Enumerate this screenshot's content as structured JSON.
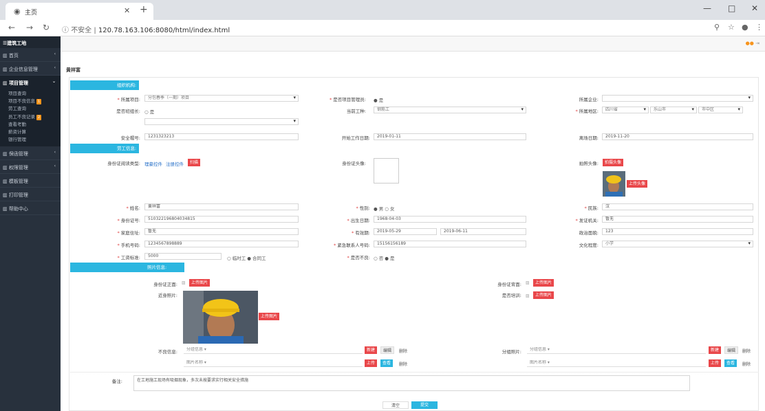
{
  "browser": {
    "tab_title": "主页",
    "url_insecure": "不安全",
    "url": "120.78.163.106:8080/html/index.html"
  },
  "sidebar": {
    "brand": "建筑工地",
    "items": [
      {
        "label": "首页",
        "arrow": "‹"
      },
      {
        "label": "企业信息管理",
        "arrow": "‹"
      },
      {
        "label": "项目管理",
        "arrow": "⌄"
      },
      {
        "label": "保函管理",
        "arrow": "‹"
      },
      {
        "label": "权限管理",
        "arrow": "‹"
      },
      {
        "label": "模板管理",
        "arrow": ""
      },
      {
        "label": "打印管理",
        "arrow": ""
      },
      {
        "label": "帮助中心",
        "arrow": ""
      }
    ],
    "subitems": [
      {
        "label": "项目查询",
        "badge": ""
      },
      {
        "label": "项目不良信息",
        "badge": "1"
      },
      {
        "label": "劳工查询",
        "badge": ""
      },
      {
        "label": "员工不良记录",
        "badge": "2"
      },
      {
        "label": "查看考勤",
        "badge": ""
      },
      {
        "label": "薪资计算",
        "badge": ""
      },
      {
        "label": "银行管理",
        "badge": ""
      }
    ]
  },
  "breadcrumb": "黄祥富",
  "form": {
    "sec1": "组织机构:",
    "sec2": "劳工信息:",
    "sec3": "照片信息:",
    "project_label": "所属项目:",
    "project_value": "分包春季（一期）项目",
    "is_pm_label": "是否项目管理员:",
    "is_pm_value": "● 是",
    "company_label": "所属企业:",
    "is_leader_label": "是否班组长:",
    "is_leader_value": "○ 是",
    "worktype_label": "当前工种:",
    "worktype_value": "钢筋工",
    "region_label": "所属地区:",
    "region_province": "四川省",
    "region_city": "乐山市",
    "region_district": "市中区",
    "safety_label": "安全帽号:",
    "safety_value": "1231323213",
    "start_label": "开始工作日期:",
    "start_value": "2019-01-11",
    "leave_label": "离场日期:",
    "leave_value": "2019-11-20",
    "idreader_label": "身份证阅读类型:",
    "driver_link": "理豪控件",
    "register_link": "注册控件",
    "scan_btn": "扫描",
    "idphoto_label": "身份证头像:",
    "capture_label": "拍照头像:",
    "capture_btn": "拍摄头像",
    "upload_avatar_btn": "上传头像",
    "name_label": "姓名:",
    "name_value": "黄祥富",
    "gender_label": "性别:",
    "gender_value": "● 男 ○ 女",
    "ethnic_label": "民族:",
    "ethnic_value": "汉",
    "id_label": "身份证号:",
    "id_value": "510322196804034815",
    "birth_label": "出生日期:",
    "birth_value": "1968-04-03",
    "issuer_label": "发证机关:",
    "issuer_value": "暂无",
    "address_label": "家庭住址:",
    "address_value": "暂无",
    "valid_label": "有效期:",
    "valid_from": "2019-05-29",
    "valid_to": "2019-06-11",
    "political_label": "政治面貌:",
    "political_value": "123",
    "phone_label": "手机号码:",
    "phone_value": "1234567898889",
    "emergency_label": "紧急联系人号码:",
    "emergency_value": "15156156189",
    "edu_label": "文化程度:",
    "edu_value": "小学",
    "wage_label": "工资标准:",
    "wage_value": "5000",
    "wage_type": "○ 临时工 ● 合同工",
    "bad_label": "是否不良:",
    "bad_value": "○ 否 ● 是",
    "idfront_label": "身份证正面:",
    "idback_label": "身份证背面:",
    "upload_img_btn": "上传图片",
    "recent_label": "近身照片:",
    "trained_label": "是否培训:",
    "badinfo_label": "不良信息:",
    "group_placeholder": "分组信息",
    "picname_placeholder": "图片名称",
    "new_btn": "新建",
    "edit_btn": "编辑",
    "delete_btn": "删除",
    "upload_btn": "上传",
    "view_btn": "查看",
    "groupphoto_label": "分组照片:",
    "remark_label": "备注:",
    "remark_value": "在工地施工现场有吸烟现象，多次未按要求实行相关安全措施",
    "clear_btn": "清空",
    "submit_btn": "提交"
  }
}
